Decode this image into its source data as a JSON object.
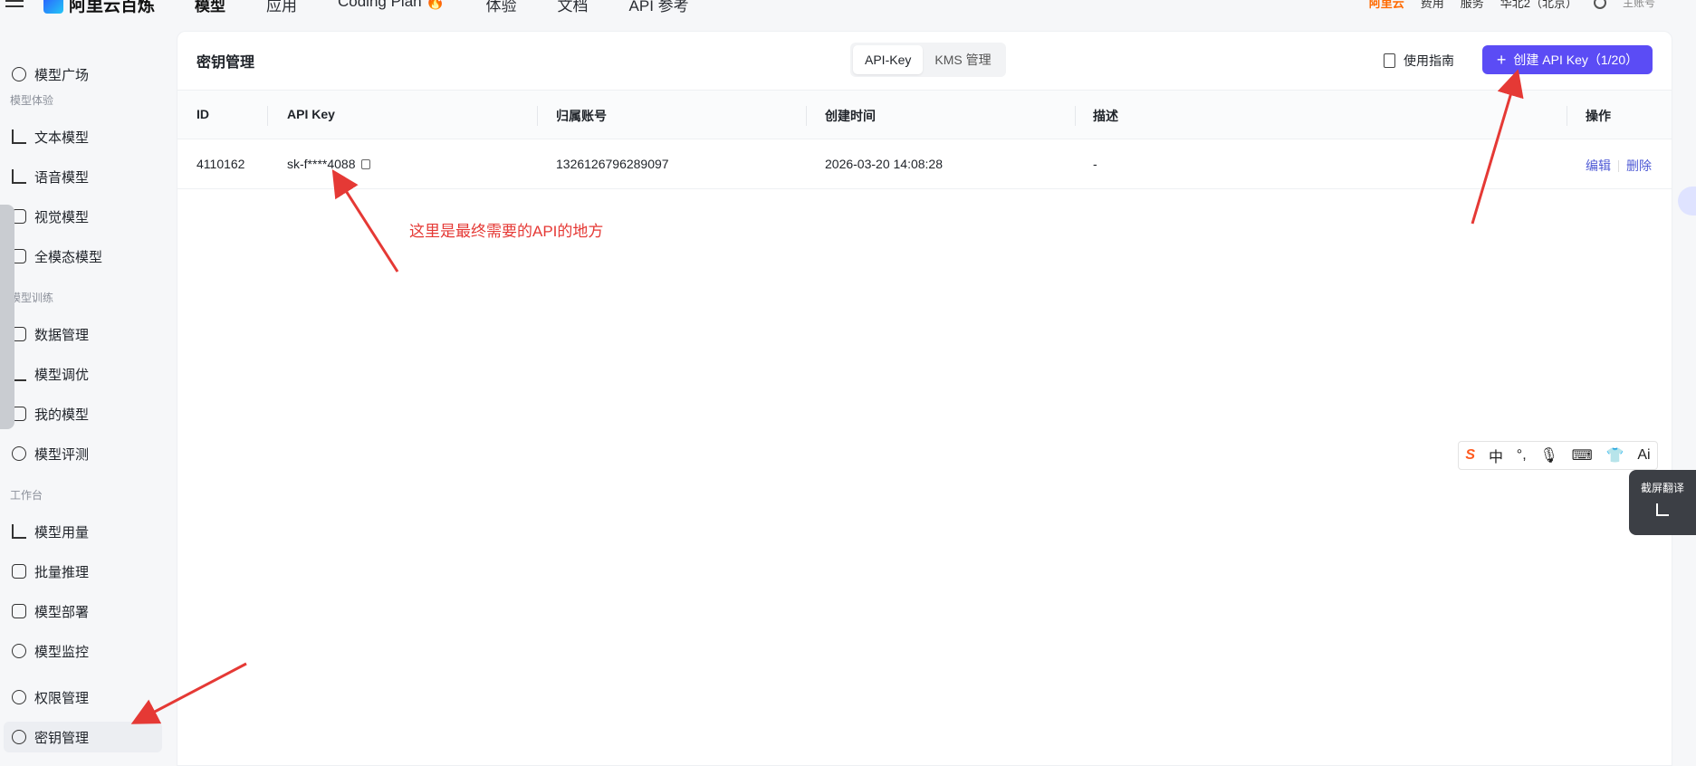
{
  "topbar": {
    "brand": "阿里云百炼",
    "nav": [
      "模型",
      "应用",
      "Coding Plan 🔥",
      "体验",
      "文档",
      "API 参考"
    ],
    "aliyun": "阿里云",
    "links": [
      "费用",
      "服务"
    ],
    "region": "华北2（北京）",
    "account_role": "主账号"
  },
  "sidebar": {
    "items_top": [
      {
        "label": "模型广场",
        "icon": "model-square-icon"
      }
    ],
    "group1": "模型体验",
    "items1": [
      {
        "label": "文本模型",
        "icon": "text-icon"
      },
      {
        "label": "语音模型",
        "icon": "waveform-icon"
      },
      {
        "label": "视觉模型",
        "icon": "camera-icon"
      },
      {
        "label": "全模态模型",
        "icon": "video-icon"
      }
    ],
    "group2": "模型训练",
    "items2": [
      {
        "label": "数据管理",
        "icon": "chart-icon"
      },
      {
        "label": "模型调优",
        "icon": "sliders-icon"
      },
      {
        "label": "我的模型",
        "icon": "grid-icon"
      },
      {
        "label": "模型评测",
        "icon": "compass-icon"
      }
    ],
    "group3": "工作台",
    "items3": [
      {
        "label": "模型用量",
        "icon": "bar-chart-icon"
      },
      {
        "label": "批量推理",
        "icon": "braces-icon"
      },
      {
        "label": "模型部署",
        "icon": "deploy-icon"
      },
      {
        "label": "模型监控",
        "icon": "pie-icon"
      }
    ],
    "items4": [
      {
        "label": "权限管理",
        "icon": "user-icon"
      },
      {
        "label": "密钥管理",
        "icon": "key-icon"
      }
    ]
  },
  "main": {
    "title": "密钥管理",
    "tabs": [
      "API-Key",
      "KMS 管理"
    ],
    "guide_label": "使用指南",
    "create_label": "创建 API Key（1/20）",
    "columns": [
      "ID",
      "API Key",
      "归属账号",
      "创建时间",
      "描述",
      "操作"
    ],
    "rows": [
      {
        "id": "4110162",
        "api_key": "sk-f****4088",
        "account": "1326126796289097",
        "created": "2026-03-20 14:08:28",
        "desc": "-",
        "edit": "编辑",
        "delete": "删除"
      }
    ]
  },
  "annotation": "这里是最终需要的API的地方",
  "ime": {
    "chars": [
      "中",
      "°,",
      "🎙",
      "⌨",
      "👕",
      "Ai"
    ]
  },
  "screenshot_translate": "截屏翻译",
  "colors": {
    "primary": "#5b4cf5",
    "annotation": "#e53935",
    "link": "#4f5bd5"
  }
}
